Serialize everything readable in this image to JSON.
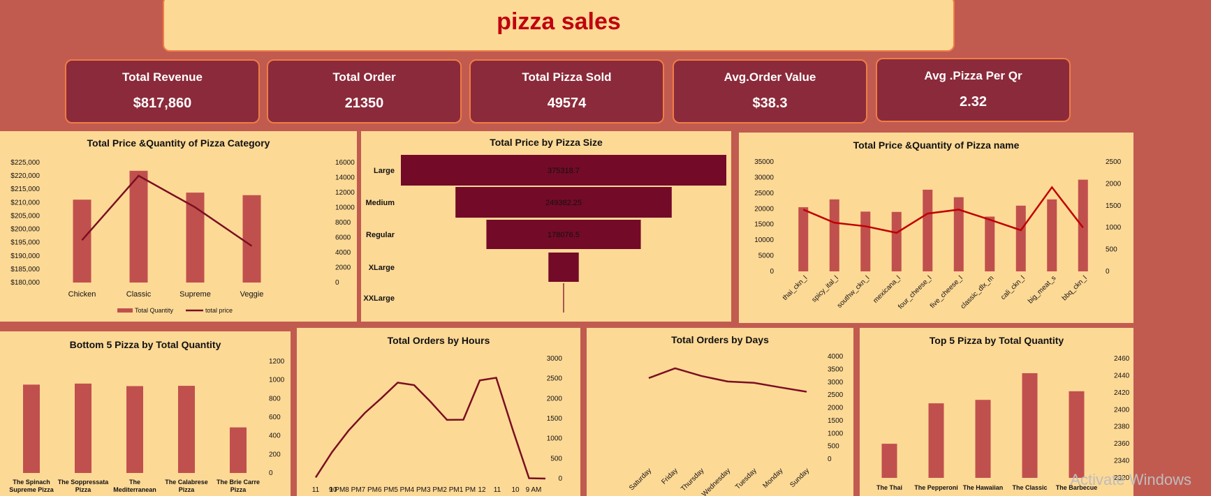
{
  "dashboard": {
    "title": "pizza sales"
  },
  "kpis": [
    {
      "label": "Total Revenue",
      "value": "$817,860"
    },
    {
      "label": "Total Order",
      "value": "21350"
    },
    {
      "label": "Total Pizza Sold",
      "value": "49574"
    },
    {
      "label": "Avg.Order Value",
      "value": "$38.3"
    },
    {
      "label": "Avg .Pizza Per Qr",
      "value": "2.32"
    }
  ],
  "colors": {
    "background": "#c15b50",
    "panel": "#fdd996",
    "kpi": "#8b2a3a",
    "bar": "#c0504d",
    "line": "#7a0f22",
    "redline": "#c00000",
    "funnel": "#730a28",
    "title": "#c0000f"
  },
  "watermark": "Activate Windows",
  "chart_data": [
    {
      "id": "category",
      "type": "bar",
      "title": "Total Price &Quantity of Pizza Category",
      "categories": [
        "Chicken",
        "Classic",
        "Supreme",
        "Veggie"
      ],
      "yticks_left": [
        "$225,000",
        "$220,000",
        "$215,000",
        "$210,000",
        "$205,000",
        "$200,000",
        "$195,000",
        "$190,000",
        "$185,000",
        "$180,000"
      ],
      "yticks_right": [
        "16000",
        "14000",
        "12000",
        "10000",
        "8000",
        "6000",
        "4000",
        "2000",
        "0"
      ],
      "series": [
        {
          "name": "Total Quantity",
          "values": [
            11050,
            14900,
            11990,
            11650
          ],
          "axis": "right",
          "kind": "bar"
        },
        {
          "name": "total price",
          "values": [
            195920,
            220050,
            208200,
            193700
          ],
          "axis": "left",
          "kind": "line"
        }
      ],
      "ylim_left": [
        180000,
        225000
      ],
      "ylim_right": [
        0,
        16000
      ],
      "legend": "bottom"
    },
    {
      "id": "size",
      "type": "bar",
      "title": "Total Price by Pizza Size",
      "categories": [
        "Large",
        "Medium",
        "Regular",
        "XLarge",
        "XXLarge"
      ],
      "values": [
        375318.7,
        249382.25,
        178076.5,
        35000,
        1000
      ],
      "data_labels": [
        "375318.7",
        "249382.25",
        "178076.5",
        "",
        ""
      ]
    },
    {
      "id": "pizzaname",
      "type": "bar",
      "title": "Total Price &Quantity of Pizza name",
      "categories": [
        "thai_ckn_l",
        "spicy_ital_l",
        "southw_ckn_l",
        "mexicana_l",
        "four_cheese_l",
        "five_cheese_l",
        "classic_dlx_m",
        "cali_ckn_l",
        "big_meat_s",
        "bbq_ckn_l"
      ],
      "yticks_left": [
        "35000",
        "30000",
        "25000",
        "20000",
        "15000",
        "10000",
        "5000",
        "0"
      ],
      "yticks_right": [
        "2500",
        "2000",
        "1500",
        "1000",
        "500",
        "0"
      ],
      "series": [
        {
          "name": "Total Price",
          "values": [
            20500,
            23000,
            19100,
            19000,
            26100,
            23700,
            17500,
            21000,
            23000,
            29300
          ],
          "axis": "left",
          "kind": "bar"
        },
        {
          "name": "Total Quantity",
          "values": [
            1410,
            1110,
            1030,
            880,
            1320,
            1410,
            1180,
            940,
            1920,
            1000
          ],
          "axis": "right",
          "kind": "line"
        }
      ],
      "ylim_left": [
        0,
        35000
      ],
      "ylim_right": [
        0,
        2500
      ]
    },
    {
      "id": "bottom5",
      "type": "bar",
      "title": "Bottom 5 Pizza by Total Quantity",
      "categories": [
        "The Spinach Supreme Pizza",
        "The Soppressata Pizza",
        "The Mediterranean Pizza",
        "The Calabrese Pizza",
        "The Brie Carre Pizza"
      ],
      "category_lines": [
        [
          "The Spinach",
          "Supreme Pizza"
        ],
        [
          "The Soppressata",
          "Pizza"
        ],
        [
          "The",
          "Mediterranean"
        ],
        [
          "The Calabrese",
          "Pizza"
        ],
        [
          "The Brie Carre",
          "Pizza"
        ]
      ],
      "yticks": [
        "1200",
        "1000",
        "800",
        "600",
        "400",
        "200",
        "0"
      ],
      "values": [
        950,
        961,
        934,
        937,
        490
      ],
      "ylim": [
        0,
        1200
      ]
    },
    {
      "id": "hours",
      "type": "line",
      "title": "Total Orders by Hours",
      "categories": [
        "11",
        "10",
        "9 PM",
        "8 PM",
        "7 PM",
        "6 PM",
        "5 PM",
        "4 PM",
        "3 PM",
        "2 PM",
        "1 PM",
        "12",
        "11",
        "10",
        "9 AM"
      ],
      "tick_labels": [
        "11",
        "10",
        "9 PM8 PM7 PM6 PM5 PM4 PM3 PM2 PM1 PM",
        "12",
        "11",
        "10",
        "9 AM"
      ],
      "yticks": [
        "3000",
        "2500",
        "2000",
        "1500",
        "1000",
        "500",
        "0"
      ],
      "values": [
        28,
        663,
        1198,
        1642,
        2009,
        2399,
        2336,
        1920,
        1468,
        1472,
        2455,
        2520,
        1231,
        8,
        1
      ],
      "ylim": [
        0,
        3000
      ]
    },
    {
      "id": "days",
      "type": "line",
      "title": "Total Orders by Days",
      "categories": [
        "Saturday",
        "Friday",
        "Thursday",
        "Wednesday",
        "Tuesday",
        "Monday",
        "Sunday"
      ],
      "yticks": [
        "4000",
        "3500",
        "3000",
        "2500",
        "2000",
        "1500",
        "1000",
        "500",
        "0"
      ],
      "values": [
        3158,
        3538,
        3239,
        3024,
        2973,
        2794,
        2624
      ],
      "ylim": [
        0,
        4000
      ]
    },
    {
      "id": "top5",
      "type": "bar",
      "title": "Top 5 Pizza by Total Quantity",
      "categories": [
        "The Thai",
        "The Pepperoni",
        "The Hawaiian",
        "The Classic",
        "The Barbecue"
      ],
      "yticks": [
        "2460",
        "2440",
        "2420",
        "2400",
        "2380",
        "2360",
        "2340",
        "2320"
      ],
      "values": [
        2371,
        2418,
        2422,
        2453,
        2432
      ],
      "ylim": [
        2320,
        2470
      ]
    }
  ]
}
